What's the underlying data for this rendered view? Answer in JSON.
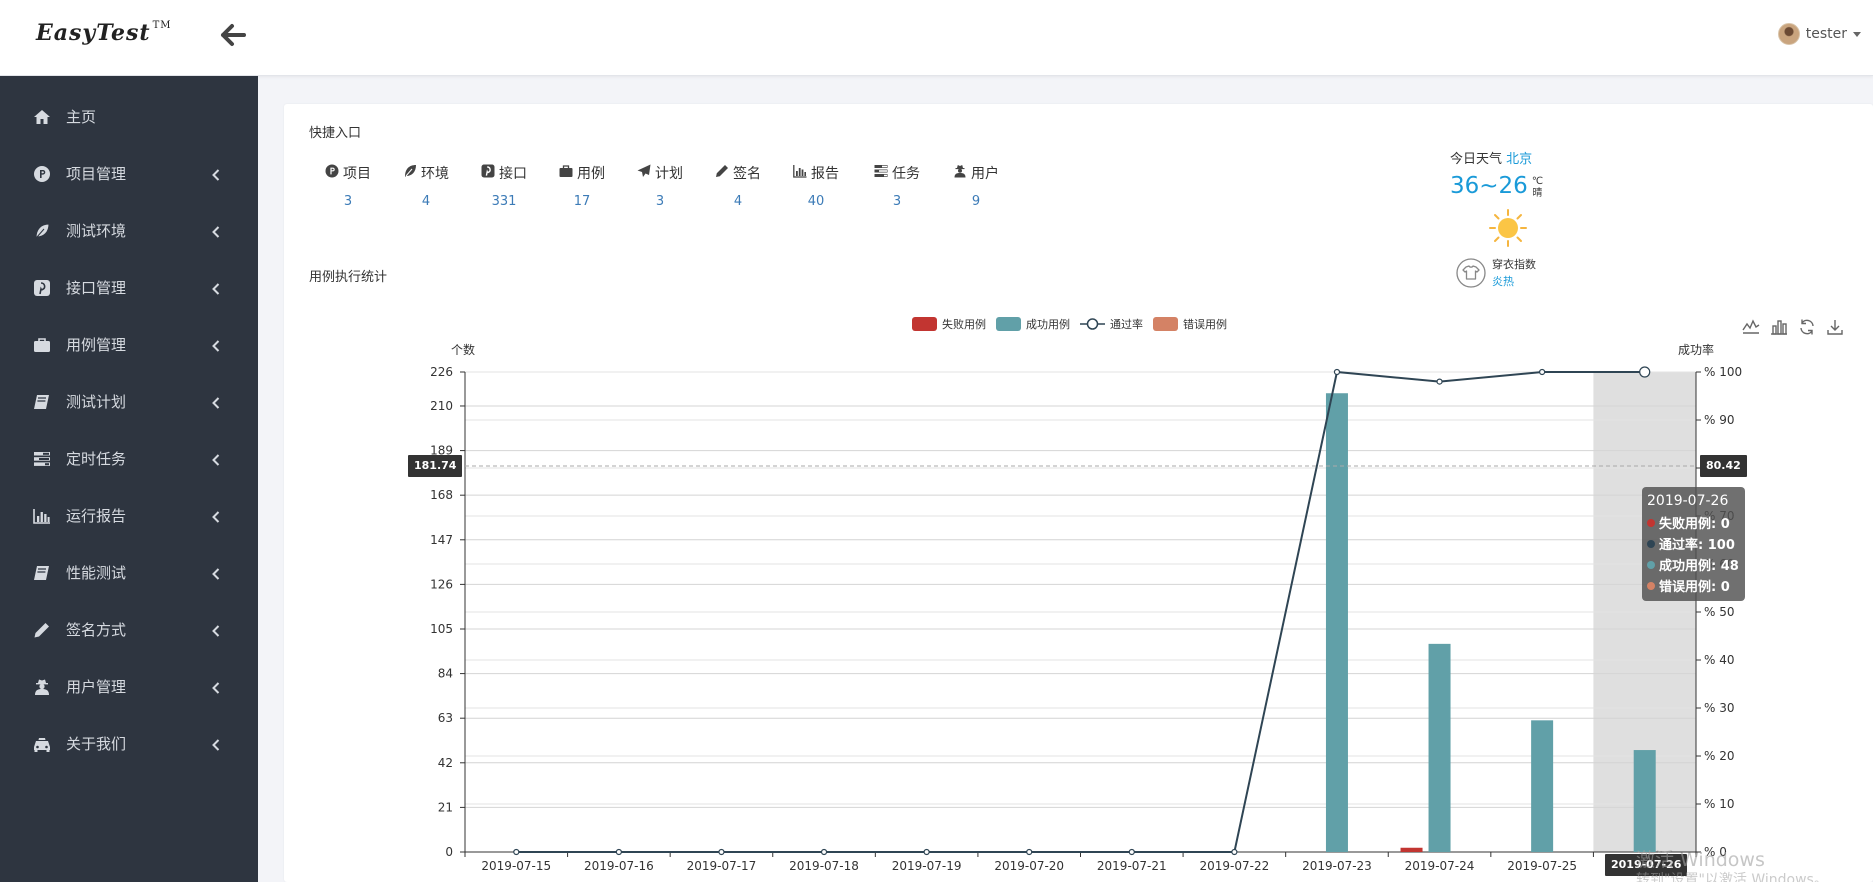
{
  "header": {
    "logo_text": "EasyTest",
    "logo_tm": "TM",
    "username": "tester"
  },
  "sidebar": {
    "items": [
      {
        "label": "主页",
        "icon": "home-icon"
      },
      {
        "label": "项目管理",
        "icon": "project-p-icon"
      },
      {
        "label": "测试环境",
        "icon": "leaf-icon"
      },
      {
        "label": "接口管理",
        "icon": "pinterest-icon"
      },
      {
        "label": "用例管理",
        "icon": "briefcase-icon"
      },
      {
        "label": "测试计划",
        "icon": "book-icon"
      },
      {
        "label": "定时任务",
        "icon": "tasks-icon"
      },
      {
        "label": "运行报告",
        "icon": "bar-chart-icon"
      },
      {
        "label": "性能测试",
        "icon": "book-icon"
      },
      {
        "label": "签名方式",
        "icon": "pencil-icon"
      },
      {
        "label": "用户管理",
        "icon": "user-secret-icon"
      },
      {
        "label": "关于我们",
        "icon": "taxi-icon"
      }
    ]
  },
  "quick_entry": {
    "title": "快捷入口",
    "items": [
      {
        "label": "项目",
        "count": "3",
        "icon": "project-p-icon"
      },
      {
        "label": "环境",
        "count": "4",
        "icon": "leaf-icon"
      },
      {
        "label": "接口",
        "count": "331",
        "icon": "pinterest-icon"
      },
      {
        "label": "用例",
        "count": "17",
        "icon": "briefcase-icon"
      },
      {
        "label": "计划",
        "count": "3",
        "icon": "paper-plane-icon"
      },
      {
        "label": "签名",
        "count": "4",
        "icon": "pencil-icon"
      },
      {
        "label": "报告",
        "count": "40",
        "icon": "bar-chart-icon"
      },
      {
        "label": "任务",
        "count": "3",
        "icon": "tasks-icon"
      },
      {
        "label": "用户",
        "count": "9",
        "icon": "user-secret-icon"
      }
    ]
  },
  "weather": {
    "title": "今日天气",
    "city": "北京",
    "temp": "36~26",
    "unit": "℃",
    "condition": "晴",
    "clothing_label": "穿衣指数",
    "clothing_value": "炎热"
  },
  "chart_section": {
    "title": "用例执行统计"
  },
  "chart_data": {
    "type": "bar",
    "categories": [
      "2019-07-15",
      "2019-07-16",
      "2019-07-17",
      "2019-07-18",
      "2019-07-19",
      "2019-07-20",
      "2019-07-21",
      "2019-07-22",
      "2019-07-23",
      "2019-07-24",
      "2019-07-25",
      "2019-07-26"
    ],
    "series": [
      {
        "name": "失败用例",
        "type": "bar",
        "color": "#c23531",
        "values": [
          0,
          0,
          0,
          0,
          0,
          0,
          0,
          0,
          0,
          2,
          0,
          0
        ]
      },
      {
        "name": "成功用例",
        "type": "bar",
        "color": "#61a0a8",
        "values": [
          0,
          0,
          0,
          0,
          0,
          0,
          0,
          0,
          216,
          98,
          62,
          48
        ]
      },
      {
        "name": "通过率",
        "type": "line",
        "color": "#2f4554",
        "axis": "right",
        "values": [
          0,
          0,
          0,
          0,
          0,
          0,
          0,
          0,
          100,
          98,
          100,
          100
        ]
      },
      {
        "name": "错误用例",
        "type": "bar",
        "color": "#d48265",
        "values": [
          0,
          0,
          0,
          0,
          0,
          0,
          0,
          0,
          0,
          0,
          0,
          0
        ]
      }
    ],
    "ylabel_left": "个数",
    "ylabel_right": "成功率",
    "ylim_left": [
      0,
      226
    ],
    "yticks_left": [
      "0",
      "21",
      "42",
      "63",
      "84",
      "105",
      "126",
      "147",
      "168",
      "189",
      "210",
      "226"
    ],
    "ytick_values_left": [
      0,
      21,
      42,
      63,
      84,
      105,
      126,
      147,
      168,
      189,
      210,
      226
    ],
    "ylim_right": [
      0,
      100
    ],
    "yticks_right": [
      "% 0",
      "% 10",
      "% 20",
      "% 30",
      "% 40",
      "% 50",
      "% 60",
      "% 70",
      "% 80",
      "% 90",
      "% 100"
    ],
    "ytick_values_right": [
      0,
      10,
      20,
      30,
      40,
      50,
      60,
      70,
      80,
      90,
      100
    ],
    "legend_position": "top-center",
    "grid": true,
    "axis_pointer": {
      "left_value": "181.74",
      "right_value": "80.42",
      "x_label": "2019-07-26"
    },
    "tooltip": {
      "date": "2019-07-26",
      "rows": [
        {
          "text": "失败用例: 0",
          "color": "#c23531"
        },
        {
          "text": "通过率: 100",
          "color": "#2f4554"
        },
        {
          "text": "成功用例: 48",
          "color": "#61a0a8"
        },
        {
          "text": "错误用例: 0",
          "color": "#d48265"
        }
      ]
    }
  },
  "watermark": {
    "line1": "激活 Windows",
    "line2": "转到\"设置\"以激活 Windows。"
  }
}
